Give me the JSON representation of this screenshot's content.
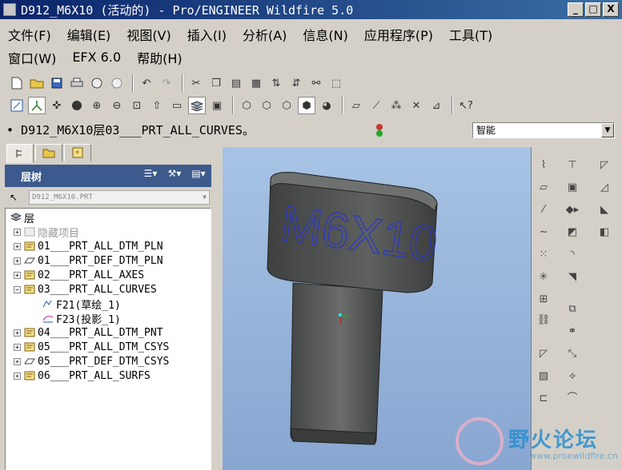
{
  "window": {
    "title": "D912_M6X10 (活动的) - Pro/ENGINEER Wildfire 5.0",
    "minimize": "_",
    "maximize": "□",
    "close": "X"
  },
  "menus": {
    "row1": [
      "文件(F)",
      "编辑(E)",
      "视图(V)",
      "插入(I)",
      "分析(A)",
      "信息(N)",
      "应用程序(P)",
      "工具(T)"
    ],
    "row2": [
      "窗口(W)",
      "EFX 6.0",
      "帮助(H)"
    ]
  },
  "message": {
    "text": "• D912_M6X10层03___PRT_ALL_CURVES。",
    "filter_value": "智能"
  },
  "navigator": {
    "header": "层树",
    "object_select": "D912_M6X10.PRT",
    "root": "层",
    "items": [
      {
        "label": "隐藏项目",
        "grey": true,
        "expander": "+"
      },
      {
        "label": "01___PRT_ALL_DTM_PLN",
        "expander": "+"
      },
      {
        "label": "01___PRT_DEF_DTM_PLN",
        "expander": "+"
      },
      {
        "label": "02___PRT_ALL_AXES",
        "expander": "+"
      },
      {
        "label": "03___PRT_ALL_CURVES",
        "expander": "−"
      },
      {
        "label": "F21(草绘_1)",
        "child": true
      },
      {
        "label": "F23(投影_1)",
        "child": true
      },
      {
        "label": "04___PRT_ALL_DTM_PNT",
        "expander": "+"
      },
      {
        "label": "05___PRT_ALL_DTM_CSYS",
        "expander": "+"
      },
      {
        "label": "05___PRT_DEF_DTM_CSYS",
        "expander": "+"
      },
      {
        "label": "06___PRT_ALL_SURFS",
        "expander": "+"
      }
    ]
  },
  "model": {
    "engraving": "M6X10",
    "body_color": "#5a5d5c",
    "text_color": "#2a35c8"
  },
  "watermark": {
    "name": "野火论坛",
    "url": "www.proewildfire.cn"
  },
  "colors": {
    "titlebar_start": "#0a246a",
    "titlebar_end": "#3a6ea5",
    "viewport_top": "#a7c3e4",
    "viewport_bottom": "#88a6d1"
  }
}
